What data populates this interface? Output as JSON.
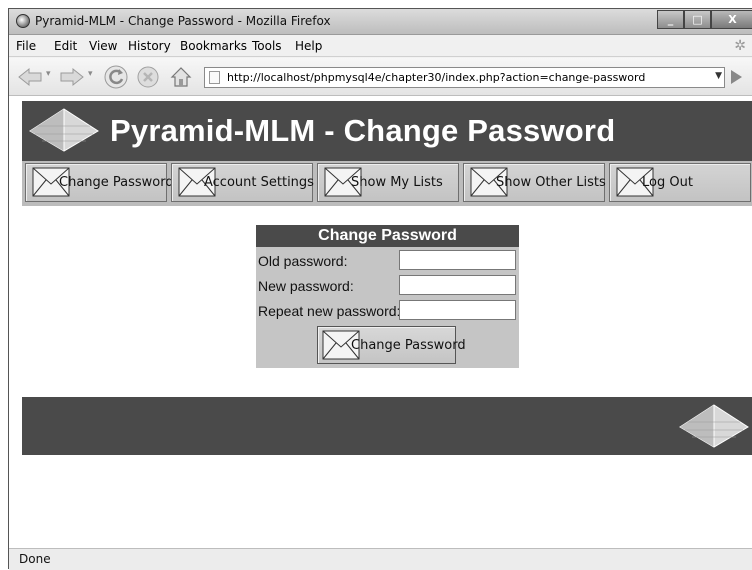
{
  "window": {
    "title": "Pyramid-MLM - Change Password - Mozilla Firefox",
    "controls": [
      "_",
      "□",
      "X"
    ]
  },
  "menubar": {
    "items": [
      "File",
      "Edit",
      "View",
      "History",
      "Bookmarks",
      "Tools",
      "Help"
    ]
  },
  "navbar": {
    "url": "http://localhost/phpmysql4e/chapter30/index.php?action=change-password"
  },
  "page": {
    "title": "Pyramid-MLM - Change Password",
    "nav": [
      {
        "label": "Change Password"
      },
      {
        "label": "Account Settings"
      },
      {
        "label": "Show My Lists"
      },
      {
        "label": "Show Other Lists"
      },
      {
        "label": "Log Out"
      }
    ],
    "form": {
      "heading": "Change Password",
      "fields": [
        {
          "label": "Old password:",
          "value": ""
        },
        {
          "label": "New password:",
          "value": ""
        },
        {
          "label": "Repeat new password:",
          "value": ""
        }
      ],
      "submit_label": "Change Password"
    }
  },
  "status": {
    "text": "Done"
  },
  "colors": {
    "header_bg": "#4a4a4a",
    "nav_bg": "#bcbcbc",
    "form_bg": "#c5c5c5"
  }
}
